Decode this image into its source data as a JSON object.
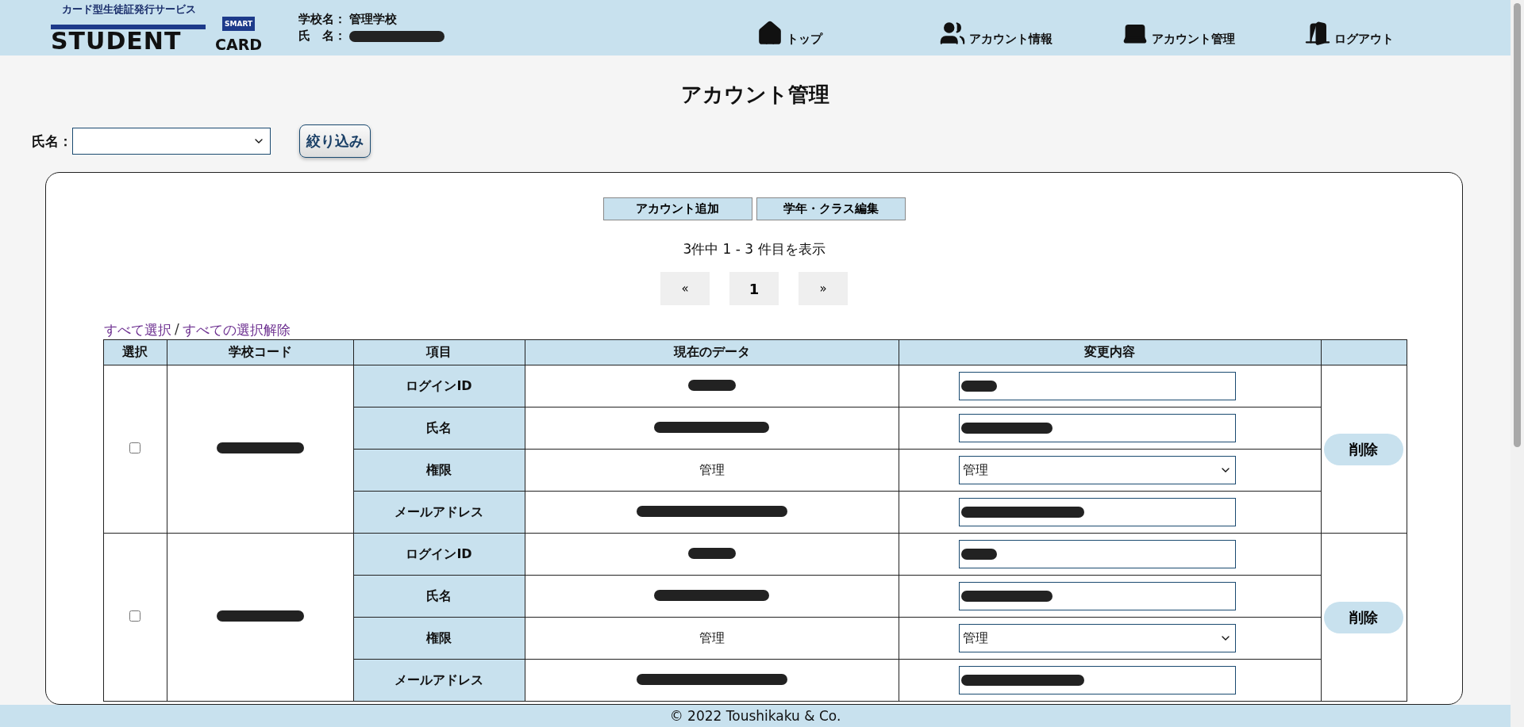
{
  "header": {
    "tagline": "カード型生徒証発行サービス",
    "brand": "STUDENT",
    "brand_sub": "CARD",
    "badge": "SMART",
    "school_label": "学校名：",
    "school": "管理学校",
    "name_label": "氏　名：",
    "nav": [
      {
        "label": "トップ"
      },
      {
        "label": "アカウント情報"
      },
      {
        "label": "アカウント管理"
      },
      {
        "label": "ログアウト"
      }
    ]
  },
  "page_title": "アカウント管理",
  "filter": {
    "label": "氏名：",
    "button": "絞り込み"
  },
  "actions": [
    "アカウント追加",
    "学年・クラス編集"
  ],
  "count": "3件中 1 - 3 件目を表示",
  "pagination": [
    {
      "label": "«",
      "selected": false
    },
    {
      "label": "1",
      "selected": true
    },
    {
      "label": "»",
      "selected": false
    }
  ],
  "select_links": {
    "all": "すべて選択",
    "separator": "/",
    "none": "すべての選択解除"
  },
  "table": {
    "columns": [
      "選択",
      "学校コード",
      "項目",
      "現在のデータ",
      "変更内容"
    ],
    "rows": [
      {
        "checked": false,
        "delete": "削除",
        "fields": [
          {
            "label": "ログインID",
            "kind": "text"
          },
          {
            "label": "氏名",
            "kind": "text"
          },
          {
            "label": "権限",
            "kind": "select",
            "current": "管理",
            "value": "管理"
          },
          {
            "label": "メールアドレス",
            "kind": "text"
          }
        ]
      },
      {
        "checked": false,
        "delete": "削除",
        "fields": [
          {
            "label": "ログインID",
            "kind": "text"
          },
          {
            "label": "氏名",
            "kind": "text"
          },
          {
            "label": "権限",
            "kind": "select",
            "current": "管理",
            "value": "管理"
          },
          {
            "label": "メールアドレス",
            "kind": "text"
          }
        ]
      }
    ]
  },
  "footer": "© 2022 Toushikaku & Co."
}
